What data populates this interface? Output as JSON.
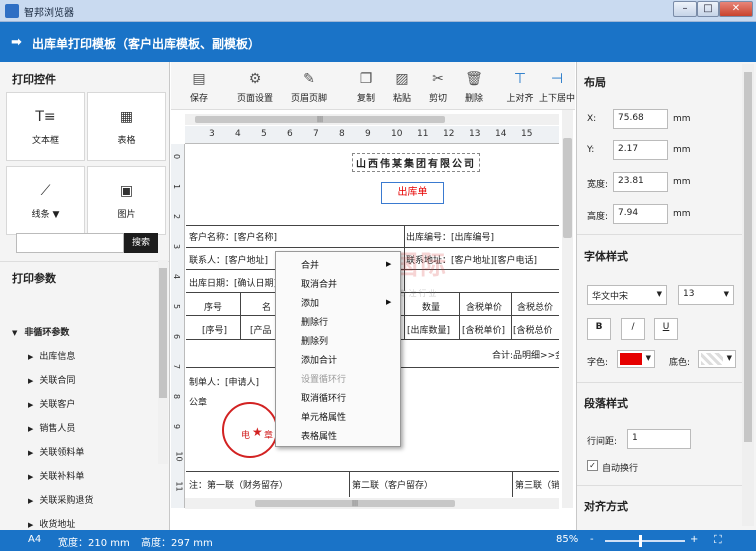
{
  "window": {
    "title": "智邦浏览器",
    "min_glyph": "–",
    "max_glyph": "□",
    "close_glyph": "✕"
  },
  "header": {
    "title": "出库单打印模板（客户出库模板、副模板）",
    "arrow_glyph": "➡"
  },
  "left_panel": {
    "controls_title": "打印控件",
    "controls": [
      {
        "label": "文本框",
        "icon": "T≡"
      },
      {
        "label": "表格",
        "icon": "▦"
      },
      {
        "label": "线条 ▼",
        "icon": "⟋"
      },
      {
        "label": "图片",
        "icon": "▣"
      }
    ],
    "params_title": "打印参数",
    "search_value": "",
    "search_button": "搜索",
    "tree_root": "非循环参数",
    "tree_items": [
      "出库信息",
      "关联合同",
      "关联客户",
      "销售人员",
      "关联领料单",
      "关联补料单",
      "关联采购退货",
      "收货地址"
    ]
  },
  "toolbar": {
    "items": [
      {
        "label": "保存",
        "icon": "▤"
      },
      {
        "label": "页面设置",
        "icon": "⚙"
      },
      {
        "label": "页眉页脚",
        "icon": "✎"
      },
      {
        "label": "复制",
        "icon": "❐"
      },
      {
        "label": "粘贴",
        "icon": "▨"
      },
      {
        "label": "剪切",
        "icon": "✂"
      },
      {
        "label": "删除",
        "icon": "🗑"
      },
      {
        "label": "上对齐",
        "icon": "⊤"
      },
      {
        "label": "上下居中",
        "icon": "⊣"
      }
    ]
  },
  "ruler": {
    "top_ticks": [
      "3",
      "4",
      "5",
      "6",
      "7",
      "8",
      "9",
      "10",
      "11",
      "12",
      "13",
      "14",
      "15"
    ],
    "left_ticks": [
      "0",
      "1",
      "2",
      "3",
      "4",
      "5",
      "6",
      "7",
      "8",
      "9",
      "10",
      "11"
    ],
    "top_scroll_thumb_glyph": "|||",
    "bottom_scroll_thumb_glyph": "|||"
  },
  "document": {
    "company": "山西伟某集团有限公司",
    "doc_title": "出库单",
    "customer_name": "客户名称：[客户名称]",
    "outbound_no": "出库编号：[出库编号]",
    "contact": "联系人：[客户地址]",
    "contact_address": "联系地址：[客户地址][客户电话]",
    "outbound_date": "出库日期：[确认日期]",
    "col_seq": "序号",
    "col_name": "名",
    "col_qty": "数量",
    "col_tax_price": "含税单价",
    "col_tax_total": "含税总价",
    "cell_seq": "[序号]",
    "cell_product": "[产品",
    "cell_qty": "[出库数量]",
    "cell_tax_price": "[含税单价]",
    "cell_tax_total": "[含税总价",
    "total_row": "合计:品明细>>金",
    "applicant": "制单人：[申请人]",
    "seal_label": "公章",
    "seal_text_left": "电",
    "seal_text_right": "章",
    "footer_1": "注：第一联（财务留存）",
    "footer_2": "第二联（客户留存）",
    "footer_3": "第三联（销"
  },
  "watermark": {
    "main": "智邦国际",
    "sub": "企业管理软件 专注行业"
  },
  "context_menu": {
    "items": [
      {
        "label": "合并",
        "submenu": true,
        "disabled": false
      },
      {
        "label": "取消合并",
        "submenu": false,
        "disabled": false
      },
      {
        "label": "添加",
        "submenu": true,
        "disabled": false
      },
      {
        "label": "删除行",
        "submenu": false,
        "disabled": false
      },
      {
        "label": "删除列",
        "submenu": false,
        "disabled": false
      },
      {
        "label": "添加合计",
        "submenu": false,
        "disabled": false
      },
      {
        "label": "设置循环行",
        "submenu": false,
        "disabled": true
      },
      {
        "label": "取消循环行",
        "submenu": false,
        "disabled": false
      },
      {
        "label": "单元格属性",
        "submenu": false,
        "disabled": false
      },
      {
        "label": "表格属性",
        "submenu": false,
        "disabled": false
      }
    ],
    "submenu_glyph": "▶"
  },
  "right_panel": {
    "layout_title": "布局",
    "x_label": "X:",
    "x_value": "75.68",
    "y_label": "Y:",
    "y_value": "2.17",
    "width_label": "宽度:",
    "width_value": "23.81",
    "height_label": "高度:",
    "height_value": "7.94",
    "unit": "mm",
    "font_title": "字体样式",
    "font_family": "华文中宋",
    "font_size": "13",
    "bold": "B",
    "italic": "/",
    "underline": "U",
    "font_color_label": "字色:",
    "bg_color_label": "底色:",
    "font_color": "#e60000",
    "para_title": "段落样式",
    "line_spacing_label": "行间距:",
    "line_spacing_value": "1",
    "autowrap_label": "自动换行",
    "autowrap_checked": "✓",
    "align_title": "对齐方式"
  },
  "status_bar": {
    "paper": "A4",
    "width": "宽度：210 mm",
    "height": "高度：297 mm",
    "zoom": "85%",
    "zoom_minus": "-",
    "zoom_plus": "+",
    "zoom_level": 0.85
  },
  "colors": {
    "accent": "#1a73c7",
    "seal": "#d22222",
    "doc_title": "#e60000"
  }
}
